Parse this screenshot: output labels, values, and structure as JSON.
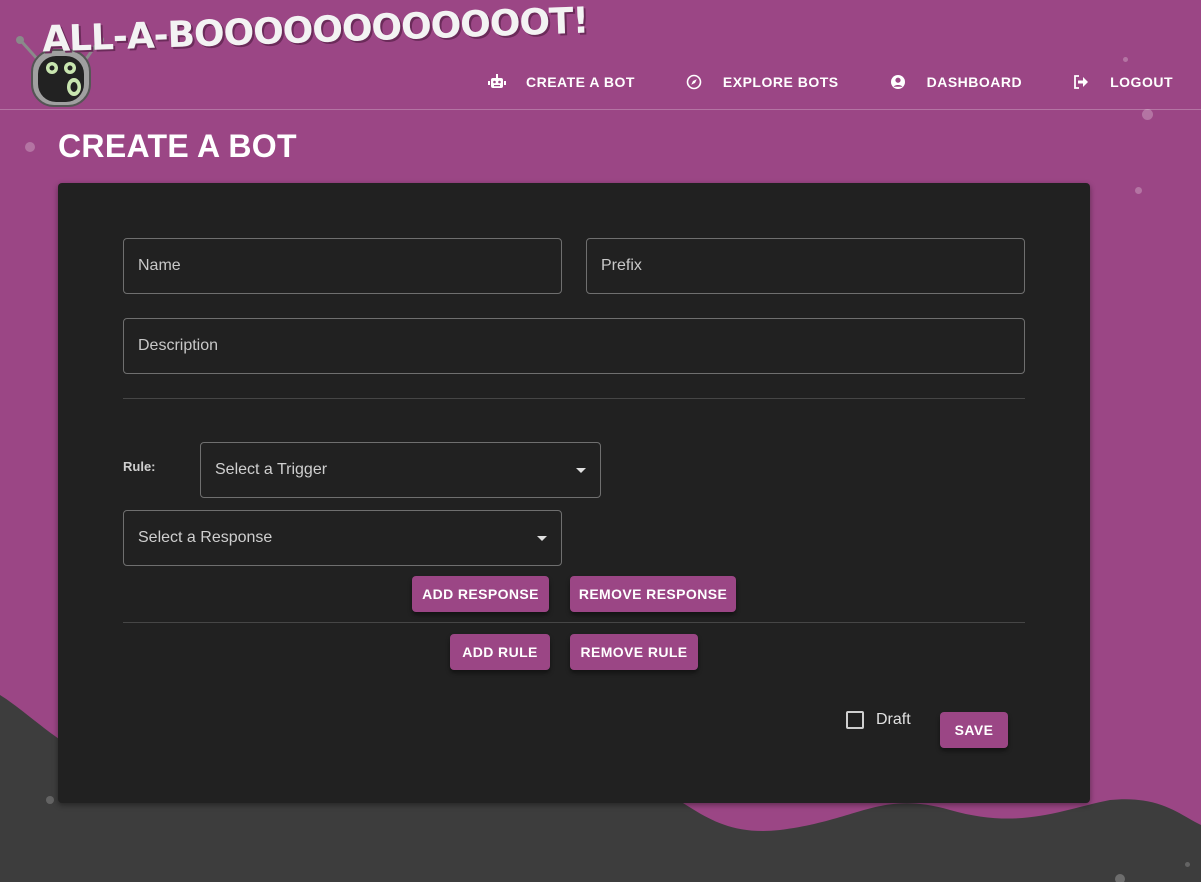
{
  "brand": {
    "logo_text": "ALL-A-BOOOOOOOOOOOOT!"
  },
  "nav": {
    "items": [
      {
        "label": "CREATE A BOT",
        "icon": "robot-icon"
      },
      {
        "label": "EXPLORE BOTS",
        "icon": "compass-icon"
      },
      {
        "label": "DASHBOARD",
        "icon": "user-circle-icon"
      },
      {
        "label": "LOGOUT",
        "icon": "sign-out-icon"
      }
    ]
  },
  "page": {
    "title": "CREATE A BOT"
  },
  "form": {
    "name_placeholder": "Name",
    "prefix_placeholder": "Prefix",
    "description_placeholder": "Description",
    "rule_label": "Rule:",
    "trigger_select": "Select a Trigger",
    "response_select": "Select a Response",
    "add_response": "ADD RESPONSE",
    "remove_response": "REMOVE RESPONSE",
    "add_rule": "ADD RULE",
    "remove_rule": "REMOVE RULE",
    "draft_label": "Draft",
    "save": "SAVE"
  },
  "colors": {
    "accent": "#9b4685",
    "card": "#212121",
    "wave": "#3d3d3d"
  }
}
